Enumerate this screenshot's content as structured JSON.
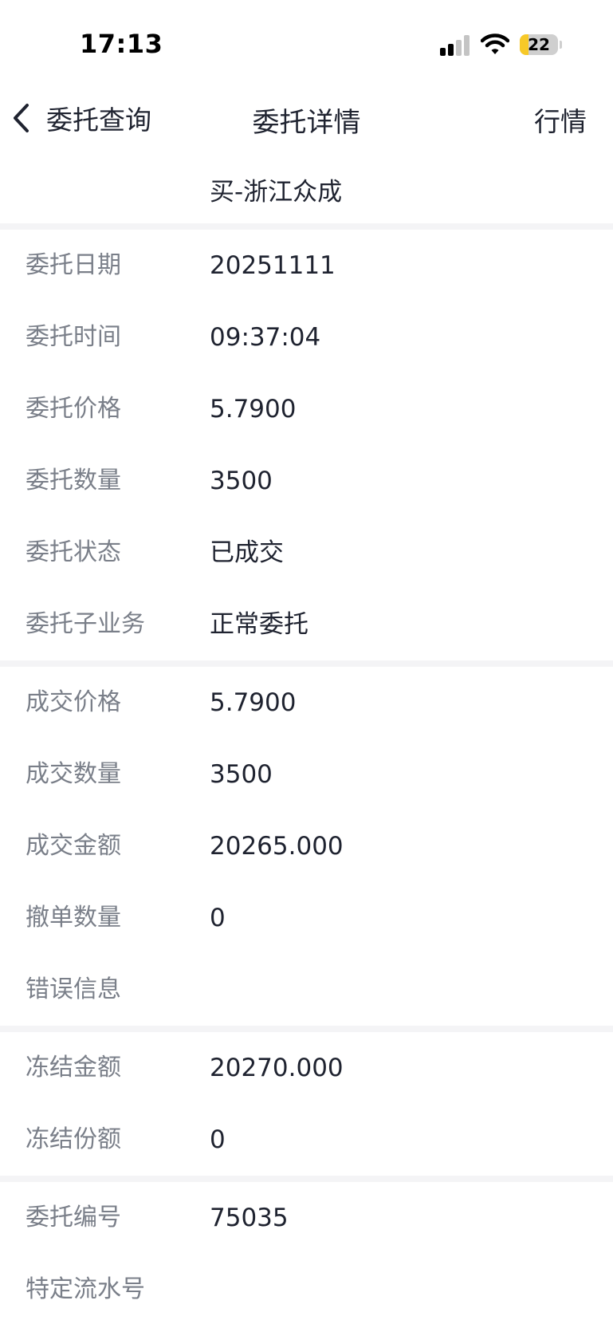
{
  "status_bar": {
    "time": "17:13",
    "battery_level": "22",
    "battery_color": "#f7c928",
    "signal_bars_active": 2,
    "signal_bars_total": 4
  },
  "nav": {
    "back_label": "委托查询",
    "title": "委托详情",
    "right_label": "行情"
  },
  "subtitle": "买-浙江众成",
  "sections": [
    {
      "rows": [
        {
          "label": "委托日期",
          "value": "20251111"
        },
        {
          "label": "委托时间",
          "value": "09:37:04"
        },
        {
          "label": "委托价格",
          "value": "5.7900"
        },
        {
          "label": "委托数量",
          "value": "3500"
        },
        {
          "label": "委托状态",
          "value": "已成交"
        },
        {
          "label": "委托子业务",
          "value": "正常委托"
        }
      ]
    },
    {
      "rows": [
        {
          "label": "成交价格",
          "value": "5.7900"
        },
        {
          "label": "成交数量",
          "value": "3500"
        },
        {
          "label": "成交金额",
          "value": "20265.000"
        },
        {
          "label": "撤单数量",
          "value": "0"
        },
        {
          "label": "错误信息",
          "value": ""
        }
      ]
    },
    {
      "rows": [
        {
          "label": "冻结金额",
          "value": "20270.000"
        },
        {
          "label": "冻结份额",
          "value": "0"
        }
      ]
    },
    {
      "rows": [
        {
          "label": "委托编号",
          "value": "75035"
        },
        {
          "label": "特定流水号",
          "value": ""
        }
      ]
    }
  ]
}
